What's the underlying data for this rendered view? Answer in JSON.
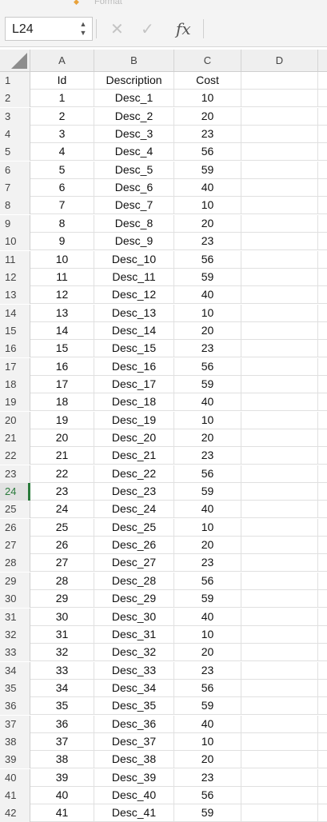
{
  "toolbar_top": {
    "partial_label": "Format"
  },
  "formula_bar": {
    "name_box": "L24",
    "cancel_symbol": "✕",
    "enter_symbol": "✓",
    "fx_label": "fx",
    "formula_value": ""
  },
  "grid": {
    "columns": [
      "A",
      "B",
      "C",
      "D"
    ],
    "selected_row": 24,
    "rows": [
      {
        "n": "1",
        "a": "Id",
        "b": "Description",
        "c": "Cost"
      },
      {
        "n": "2",
        "a": "1",
        "b": "Desc_1",
        "c": "10"
      },
      {
        "n": "3",
        "a": "2",
        "b": "Desc_2",
        "c": "20"
      },
      {
        "n": "4",
        "a": "3",
        "b": "Desc_3",
        "c": "23"
      },
      {
        "n": "5",
        "a": "4",
        "b": "Desc_4",
        "c": "56"
      },
      {
        "n": "6",
        "a": "5",
        "b": "Desc_5",
        "c": "59"
      },
      {
        "n": "7",
        "a": "6",
        "b": "Desc_6",
        "c": "40"
      },
      {
        "n": "8",
        "a": "7",
        "b": "Desc_7",
        "c": "10"
      },
      {
        "n": "9",
        "a": "8",
        "b": "Desc_8",
        "c": "20"
      },
      {
        "n": "10",
        "a": "9",
        "b": "Desc_9",
        "c": "23"
      },
      {
        "n": "11",
        "a": "10",
        "b": "Desc_10",
        "c": "56"
      },
      {
        "n": "12",
        "a": "11",
        "b": "Desc_11",
        "c": "59"
      },
      {
        "n": "13",
        "a": "12",
        "b": "Desc_12",
        "c": "40"
      },
      {
        "n": "14",
        "a": "13",
        "b": "Desc_13",
        "c": "10"
      },
      {
        "n": "15",
        "a": "14",
        "b": "Desc_14",
        "c": "20"
      },
      {
        "n": "16",
        "a": "15",
        "b": "Desc_15",
        "c": "23"
      },
      {
        "n": "17",
        "a": "16",
        "b": "Desc_16",
        "c": "56"
      },
      {
        "n": "18",
        "a": "17",
        "b": "Desc_17",
        "c": "59"
      },
      {
        "n": "19",
        "a": "18",
        "b": "Desc_18",
        "c": "40"
      },
      {
        "n": "20",
        "a": "19",
        "b": "Desc_19",
        "c": "10"
      },
      {
        "n": "21",
        "a": "20",
        "b": "Desc_20",
        "c": "20"
      },
      {
        "n": "22",
        "a": "21",
        "b": "Desc_21",
        "c": "23"
      },
      {
        "n": "23",
        "a": "22",
        "b": "Desc_22",
        "c": "56"
      },
      {
        "n": "24",
        "a": "23",
        "b": "Desc_23",
        "c": "59"
      },
      {
        "n": "25",
        "a": "24",
        "b": "Desc_24",
        "c": "40"
      },
      {
        "n": "26",
        "a": "25",
        "b": "Desc_25",
        "c": "10"
      },
      {
        "n": "27",
        "a": "26",
        "b": "Desc_26",
        "c": "20"
      },
      {
        "n": "28",
        "a": "27",
        "b": "Desc_27",
        "c": "23"
      },
      {
        "n": "29",
        "a": "28",
        "b": "Desc_28",
        "c": "56"
      },
      {
        "n": "30",
        "a": "29",
        "b": "Desc_29",
        "c": "59"
      },
      {
        "n": "31",
        "a": "30",
        "b": "Desc_30",
        "c": "40"
      },
      {
        "n": "32",
        "a": "31",
        "b": "Desc_31",
        "c": "10"
      },
      {
        "n": "33",
        "a": "32",
        "b": "Desc_32",
        "c": "20"
      },
      {
        "n": "34",
        "a": "33",
        "b": "Desc_33",
        "c": "23"
      },
      {
        "n": "35",
        "a": "34",
        "b": "Desc_34",
        "c": "56"
      },
      {
        "n": "36",
        "a": "35",
        "b": "Desc_35",
        "c": "59"
      },
      {
        "n": "37",
        "a": "36",
        "b": "Desc_36",
        "c": "40"
      },
      {
        "n": "38",
        "a": "37",
        "b": "Desc_37",
        "c": "10"
      },
      {
        "n": "39",
        "a": "38",
        "b": "Desc_38",
        "c": "20"
      },
      {
        "n": "40",
        "a": "39",
        "b": "Desc_39",
        "c": "23"
      },
      {
        "n": "41",
        "a": "40",
        "b": "Desc_40",
        "c": "56"
      },
      {
        "n": "42",
        "a": "41",
        "b": "Desc_41",
        "c": "59"
      }
    ]
  },
  "colors": {
    "selection_accent": "#2a7a3b"
  },
  "icons": [
    "stepper-icon",
    "cancel-icon",
    "enter-icon",
    "function-icon",
    "select-all-icon"
  ]
}
